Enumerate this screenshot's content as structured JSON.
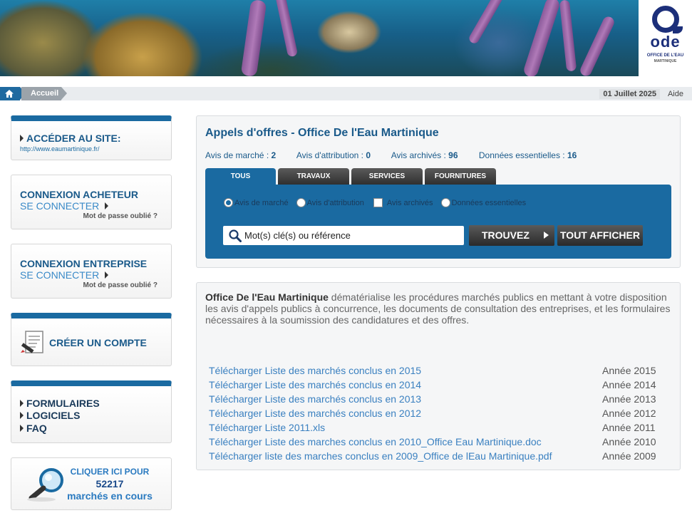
{
  "banner": {
    "logo_name": "ode",
    "logo_sub": "OFFICE DE L'EAU",
    "logo_sub2": "MARTINIQUE"
  },
  "breadcrumb": {
    "home_icon": "home-icon",
    "current": "Accueil",
    "date": "01 Juillet 2025",
    "help": "Aide"
  },
  "sidebar": {
    "site": {
      "title": "ACCÉDER AU SITE:",
      "url": "http://www.eaumartinique.fr/"
    },
    "buyer": {
      "title": "CONNEXION ACHETEUR",
      "connect": "SE CONNECTER",
      "forgot": "Mot de passe oublié ?"
    },
    "company": {
      "title": "CONNEXION ENTREPRISE",
      "connect": "SE CONNECTER",
      "forgot": "Mot de passe oublié ?"
    },
    "create": {
      "title": "CRÉER UN COMPTE",
      "icon": "form-pen-icon"
    },
    "links": [
      "FORMULAIRES",
      "LOGICIELS",
      "FAQ"
    ],
    "promo": {
      "line1": "CLIQUER ICI POUR",
      "count": "52217",
      "line3": "marchés en cours",
      "icon": "magnifier-icon"
    }
  },
  "main": {
    "title": "Appels d'offres - Office De l'Eau Martinique",
    "counts": [
      {
        "label": "Avis de marché :",
        "value": "2"
      },
      {
        "label": "Avis d'attribution :",
        "value": "0"
      },
      {
        "label": "Avis archivés :",
        "value": "96"
      },
      {
        "label": "Données essentielles :",
        "value": "16"
      }
    ],
    "tabs": [
      "TOUS",
      "TRAVAUX",
      "SERVICES",
      "FOURNITURES"
    ],
    "filters": {
      "opt1": "Avis de marché",
      "opt2": "Avis d'attribution",
      "opt3": "Avis archivés",
      "opt4": "Données essentielles"
    },
    "search": {
      "placeholder": "Mot(s) clé(s) ou référence",
      "find": "TROUVEZ",
      "all": "TOUT AFFICHER"
    }
  },
  "info": {
    "org": "Office De l'Eau Martinique",
    "text": " dématérialise les procédures marchés publics en mettant à votre disposition les avis d'appels publics à concurrence, les documents de consultation des entreprises, et les formulaires nécessaires à la soumission des candidatures et des offres.",
    "downloads": [
      {
        "label": "Télécharger Liste des marchés conclus en 2015",
        "year": "Année 2015"
      },
      {
        "label": "Télécharger Liste des marchés conclus en 2014",
        "year": "Année 2014"
      },
      {
        "label": "Télécharger Liste des marchés conclus en 2013",
        "year": "Année 2013"
      },
      {
        "label": "Télécharger Liste des marchés conclus en 2012",
        "year": "Année 2012"
      },
      {
        "label": "Télécharger Liste 2011.xls",
        "year": "Année 2011"
      },
      {
        "label": "Télécharger Liste des marches conclus en 2010_Office Eau Martinique.doc",
        "year": "Année 2010"
      },
      {
        "label": "Télécharger liste des marches conclus en 2009_Office de lEau Martinique.pdf",
        "year": "Année 2009"
      }
    ]
  }
}
